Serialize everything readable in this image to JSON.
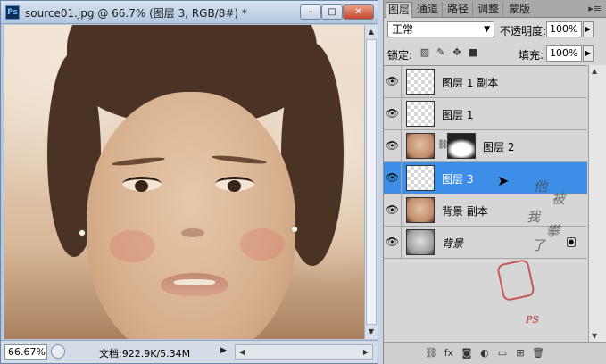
{
  "document_window": {
    "app_icon": "Ps",
    "title": "source01.jpg @ 66.7% (图层 3, RGB/8#) *",
    "minimize_icon": "minimize-icon",
    "maximize_icon": "maximize-icon",
    "close_icon": "close-icon",
    "status": {
      "zoom": "66.67%",
      "doc_info": "文档:922.9K/5.34M"
    }
  },
  "layers_panel": {
    "tabs": [
      "图层",
      "通道",
      "路径",
      "调整",
      "蒙版"
    ],
    "active_tab": 0,
    "blend_mode": "正常",
    "opacity_label": "不透明度:",
    "opacity": "100%",
    "lock_label": "锁定:",
    "fill_label": "填充:",
    "fill": "100%",
    "layers": [
      {
        "name": "图层 1 副本",
        "visible": true,
        "selected": false,
        "thumb": "transparent"
      },
      {
        "name": "图层 1",
        "visible": true,
        "selected": false,
        "thumb": "transparent"
      },
      {
        "name": "图层 2",
        "visible": true,
        "selected": false,
        "thumb": "face",
        "has_mask": true
      },
      {
        "name": "图层 3",
        "visible": true,
        "selected": true,
        "thumb": "transparent"
      },
      {
        "name": "背景 副本",
        "visible": true,
        "selected": false,
        "thumb": "face"
      },
      {
        "name": "背景",
        "visible": true,
        "selected": false,
        "thumb": "face-bw",
        "locked": true
      }
    ],
    "watermark_text": "他被我攀了"
  },
  "colors": {
    "selection": "#3d8ee6",
    "panel_bg": "#d6d6d6",
    "window_frame": "#b9c9dc",
    "stamp_red": "#c23a3a"
  }
}
